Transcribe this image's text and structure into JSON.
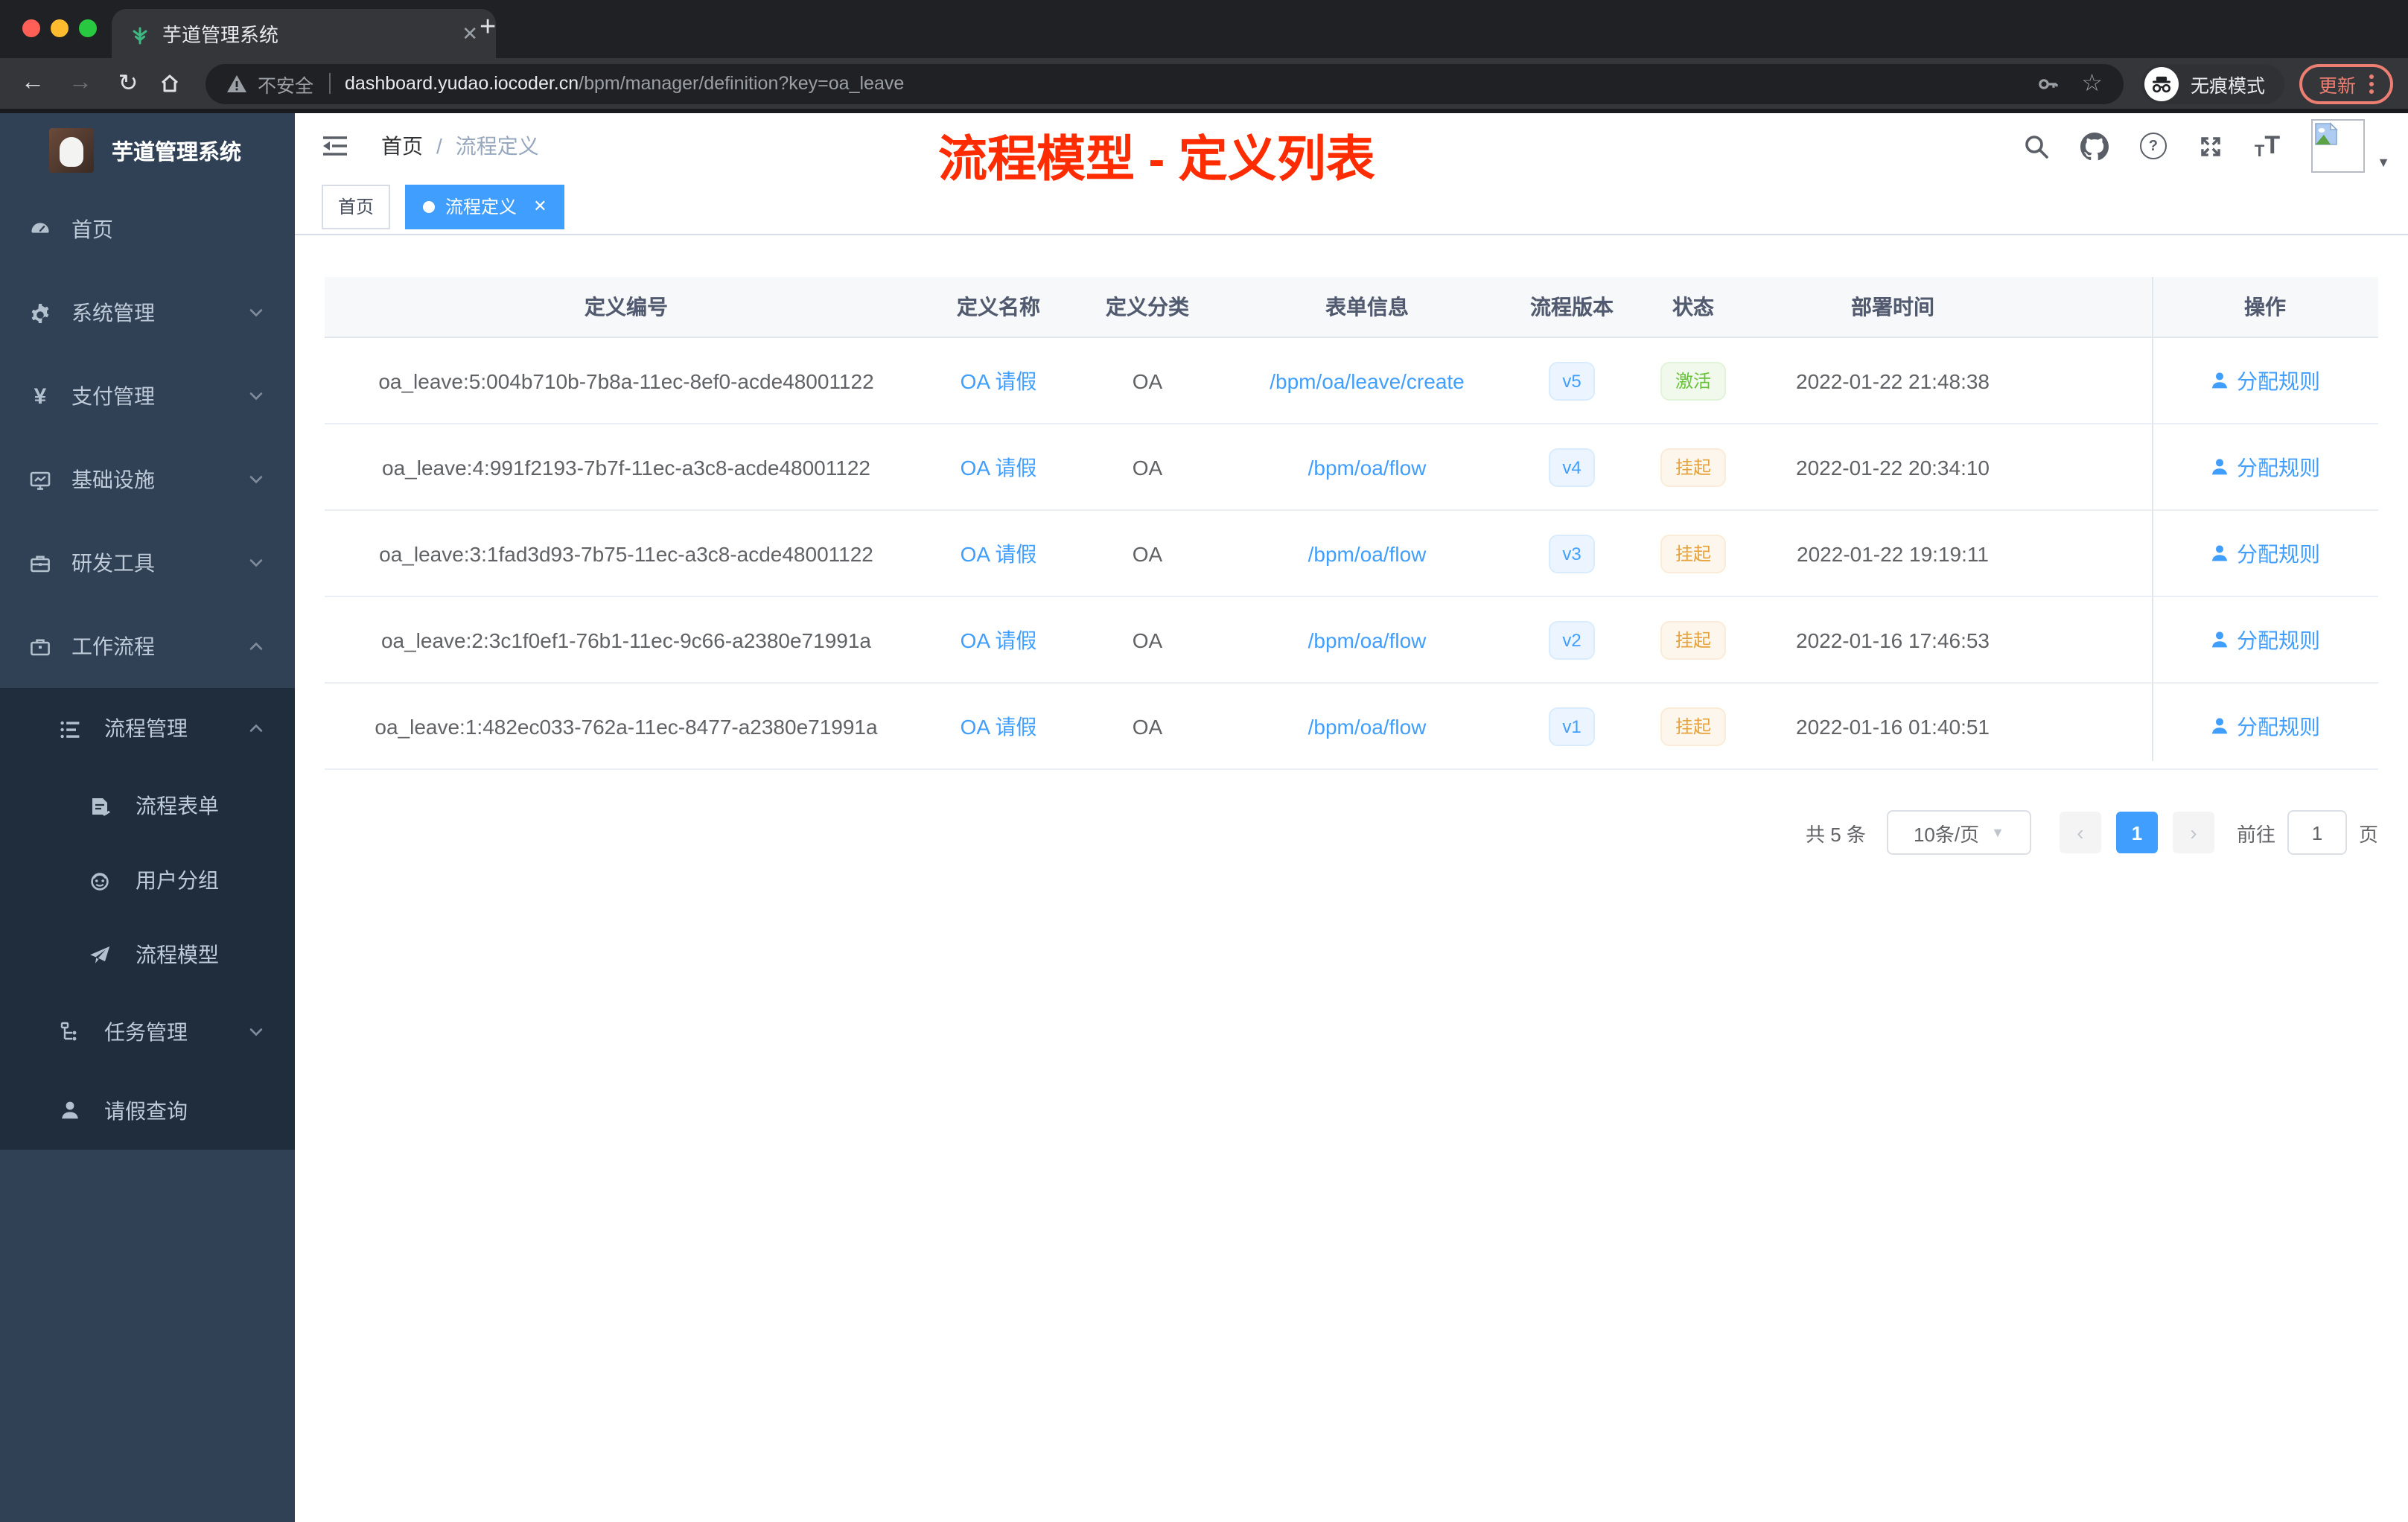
{
  "browser": {
    "tab_title": "芋道管理系统",
    "tab_close": "✕",
    "new_tab": "+",
    "back": "←",
    "forward": "→",
    "reload": "↻",
    "insecure_label": "不安全",
    "url_domain": "dashboard.yudao.iocoder.cn",
    "url_path": "/bpm/manager/definition?key=oa_leave",
    "star": "☆",
    "incognito_label": "无痕模式",
    "update_label": "更新"
  },
  "sidebar": {
    "logo_title": "芋道管理系统",
    "items": [
      {
        "label": "首页"
      },
      {
        "label": "系统管理"
      },
      {
        "label": "支付管理"
      },
      {
        "label": "基础设施"
      },
      {
        "label": "研发工具"
      },
      {
        "label": "工作流程"
      },
      {
        "label": "流程管理"
      },
      {
        "label": "流程表单"
      },
      {
        "label": "用户分组"
      },
      {
        "label": "流程模型"
      },
      {
        "label": "任务管理"
      },
      {
        "label": "请假查询"
      }
    ]
  },
  "header": {
    "breadcrumb": [
      "首页",
      "流程定义"
    ],
    "separator": "/",
    "annotation": "流程模型 - 定义列表",
    "help_glyph": "?"
  },
  "tabs": [
    {
      "label": "首页"
    },
    {
      "label": "流程定义",
      "close": "✕"
    }
  ],
  "table": {
    "columns": [
      "定义编号",
      "定义名称",
      "定义分类",
      "表单信息",
      "流程版本",
      "状态",
      "部署时间",
      "操作"
    ],
    "rows": [
      {
        "id": "oa_leave:5:004b710b-7b8a-11ec-8ef0-acde48001122",
        "name": "OA 请假",
        "category": "OA",
        "form": "/bpm/oa/leave/create",
        "version": "v5",
        "status": "激活",
        "status_type": "success",
        "deploy_time": "2022-01-22 21:48:38",
        "action": "分配规则"
      },
      {
        "id": "oa_leave:4:991f2193-7b7f-11ec-a3c8-acde48001122",
        "name": "OA 请假",
        "category": "OA",
        "form": "/bpm/oa/flow",
        "version": "v4",
        "status": "挂起",
        "status_type": "warning",
        "deploy_time": "2022-01-22 20:34:10",
        "action": "分配规则"
      },
      {
        "id": "oa_leave:3:1fad3d93-7b75-11ec-a3c8-acde48001122",
        "name": "OA 请假",
        "category": "OA",
        "form": "/bpm/oa/flow",
        "version": "v3",
        "status": "挂起",
        "status_type": "warning",
        "deploy_time": "2022-01-22 19:19:11",
        "action": "分配规则"
      },
      {
        "id": "oa_leave:2:3c1f0ef1-76b1-11ec-9c66-a2380e71991a",
        "name": "OA 请假",
        "category": "OA",
        "form": "/bpm/oa/flow",
        "version": "v2",
        "status": "挂起",
        "status_type": "warning",
        "deploy_time": "2022-01-16 17:46:53",
        "action": "分配规则"
      },
      {
        "id": "oa_leave:1:482ec033-762a-11ec-8477-a2380e71991a",
        "name": "OA 请假",
        "category": "OA",
        "form": "/bpm/oa/flow",
        "version": "v1",
        "status": "挂起",
        "status_type": "warning",
        "deploy_time": "2022-01-16 01:40:51",
        "action": "分配规则"
      }
    ]
  },
  "pagination": {
    "total": "共 5 条",
    "page_size": "10条/页",
    "prev": "‹",
    "next": "›",
    "current_page": "1",
    "goto_label": "前往",
    "goto_value": "1",
    "unit_label": "页"
  },
  "colors": {
    "accent": "#409eff",
    "success": "#67c23a",
    "warning": "#e6a23c",
    "annotation_red": "#fe2c00",
    "sidebar_bg": "#304156",
    "sidebar_sub_bg": "#1f2d3d"
  }
}
